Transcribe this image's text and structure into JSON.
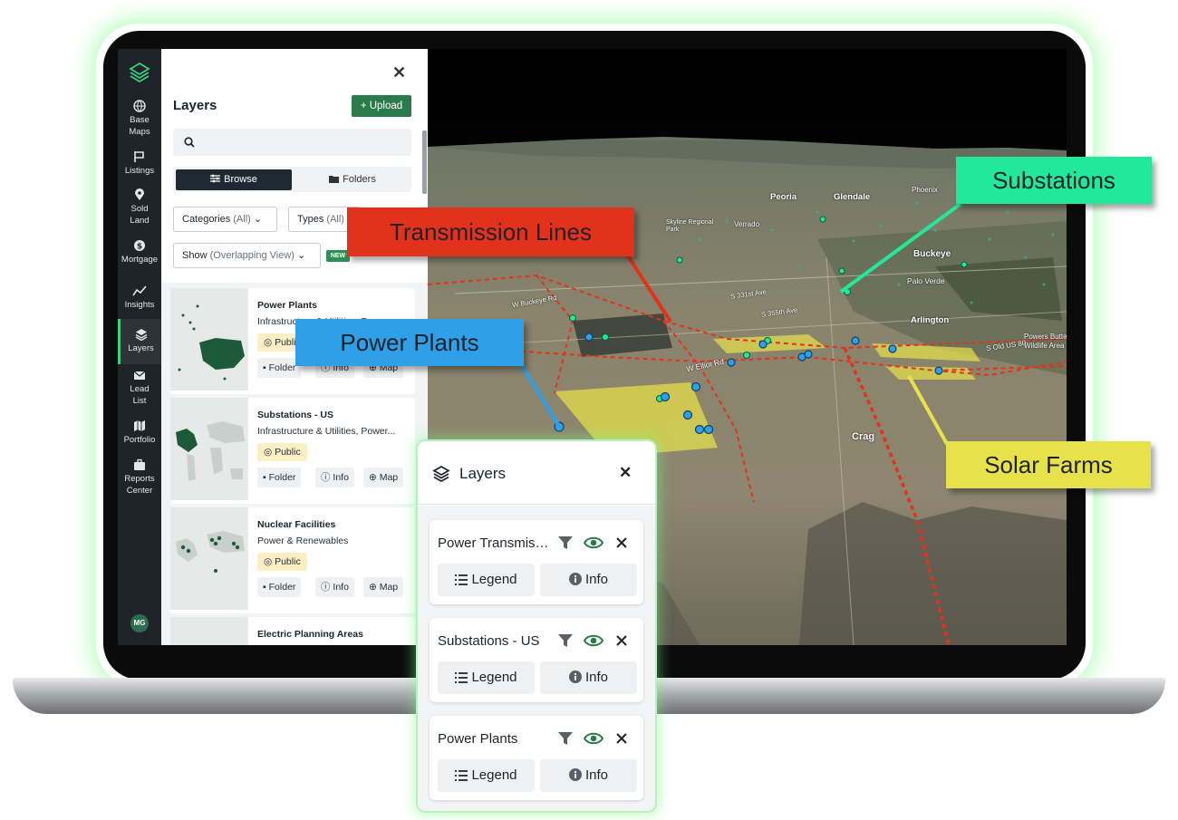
{
  "sidebar": {
    "items": [
      {
        "label": "Base\nMaps",
        "l1": "Base",
        "l2": "Maps"
      },
      {
        "label": "Listings"
      },
      {
        "label": "Sold\nLand",
        "l1": "Sold",
        "l2": "Land"
      },
      {
        "label": "Mortgage"
      },
      {
        "label": "Insights"
      },
      {
        "label": "Layers"
      },
      {
        "label": "Lead\nList",
        "l1": "Lead",
        "l2": "List"
      },
      {
        "label": "Portfolio"
      },
      {
        "label": "Reports\nCenter",
        "l1": "Reports",
        "l2": "Center"
      }
    ],
    "avatar": "MG",
    "active": "Layers"
  },
  "panel": {
    "title": "Layers",
    "upload_label": "Upload",
    "tabs": {
      "browse": "Browse",
      "folders": "Folders"
    },
    "filters": {
      "categories_label": "Categories",
      "categories_value": "(All)",
      "types_label": "Types",
      "types_value": "(All)",
      "show_label": "Show",
      "show_value": "(Overlapping View)",
      "new_badge": "NEW"
    },
    "cards": [
      {
        "title": "Power Plants",
        "subtitle": "Infrastructure & Utilities, Power...",
        "badge": "Public",
        "folder": "Folder",
        "info": "Info",
        "map": "Map"
      },
      {
        "title": "Substations - US",
        "subtitle": "Infrastructure & Utilities, Power...",
        "badge": "Public",
        "folder": "Folder",
        "info": "Info",
        "map": "Map"
      },
      {
        "title": "Nuclear Facilities",
        "subtitle": "Power & Renewables",
        "badge": "Public",
        "folder": "Folder",
        "info": "Info",
        "map": "Map"
      },
      {
        "title": "Electric Planning Areas"
      }
    ]
  },
  "callouts": {
    "transmission": "Transmission Lines",
    "substations": "Substations",
    "power_plants": "Power Plants",
    "solar": "Solar Farms"
  },
  "map_labels": {
    "places": [
      "Peoria",
      "Glendale",
      "Phoenix",
      "Buckeye",
      "Palo Verde",
      "Arlington",
      "Powers Butte Wildlife Area",
      "Crag",
      "Skyline Regional Park",
      "Verrado"
    ],
    "roads": [
      "W Elliot Rd",
      "S 355th Ave",
      "S 331st Ave",
      "S Old US 80",
      "W Buckeye Rd"
    ]
  },
  "colors": {
    "transmission": "#e3321c",
    "substations": "#21e89a",
    "power_plants": "#2f9fe8",
    "solar": "#e8e24a",
    "accent": "#2b7a4b"
  },
  "layers_panel": {
    "title": "Layers",
    "layers": [
      {
        "name": "Power Transmission Lines",
        "legend": "Legend",
        "info": "Info"
      },
      {
        "name": "Substations - US",
        "legend": "Legend",
        "info": "Info"
      },
      {
        "name": "Power Plants",
        "legend": "Legend",
        "info": "Info"
      }
    ]
  }
}
